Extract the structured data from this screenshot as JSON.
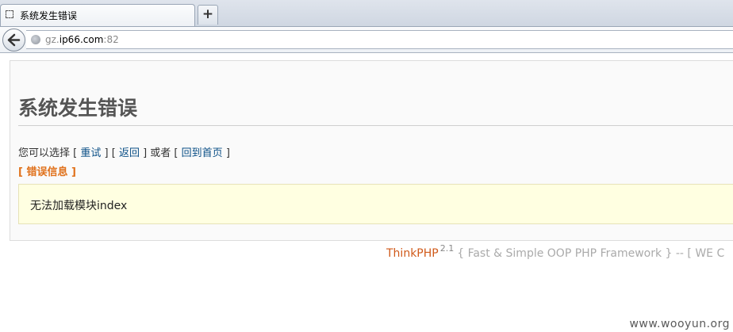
{
  "browser": {
    "tab_title": "系统发生错误",
    "new_tab_label": "+",
    "url_prefix": "gz.",
    "url_host": "ip66.com",
    "url_port": ":82"
  },
  "page": {
    "title": "系统发生错误",
    "choice_prefix": "您可以选择 [",
    "retry_link": "重试",
    "sep1": "] [",
    "back_link": "返回",
    "sep2": "] 或者 [",
    "home_link": "回到首页",
    "suffix": "]",
    "error_info_label": "[ 错误信息 ]",
    "error_message": "无法加载模块index"
  },
  "footer": {
    "brand": "ThinkPHP",
    "version": "2.1",
    "tagline": "{ Fast & Simple OOP PHP Framework } -- [ WE C"
  },
  "watermark": "www.wooyun.org"
}
